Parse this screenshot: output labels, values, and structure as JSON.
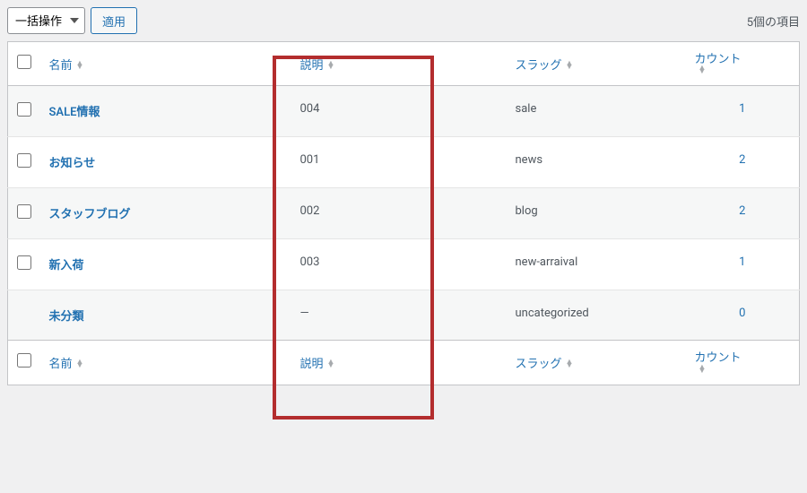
{
  "toolbar": {
    "bulk_action_label": "一括操作",
    "apply_label": "適用",
    "item_count_label": "5個の項目"
  },
  "columns": {
    "name": "名前",
    "description": "説明",
    "slug": "スラッグ",
    "count": "カウント"
  },
  "rows": [
    {
      "name": "SALE情報",
      "description": "004",
      "slug": "sale",
      "count": "1",
      "checkable": true
    },
    {
      "name": "お知らせ",
      "description": "001",
      "slug": "news",
      "count": "2",
      "checkable": true
    },
    {
      "name": "スタッフブログ",
      "description": "002",
      "slug": "blog",
      "count": "2",
      "checkable": true
    },
    {
      "name": "新入荷",
      "description": "003",
      "slug": "new-arraival",
      "count": "1",
      "checkable": true
    },
    {
      "name": "未分類",
      "description": "—",
      "slug": "uncategorized",
      "count": "0",
      "checkable": false
    }
  ]
}
